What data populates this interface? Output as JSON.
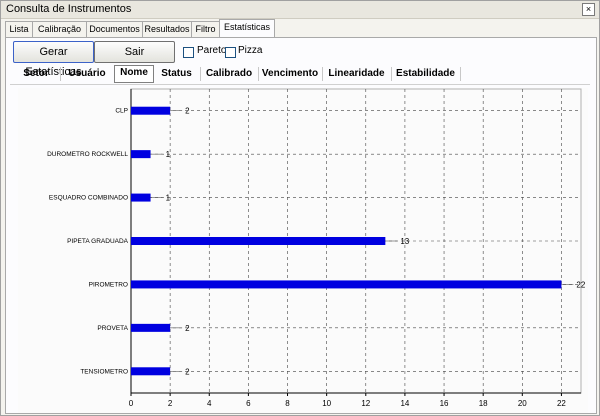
{
  "window": {
    "title": "Consulta de Instrumentos",
    "close_glyph": "×"
  },
  "tabs": [
    {
      "label": "Lista"
    },
    {
      "label": "Calibração"
    },
    {
      "label": "Documentos"
    },
    {
      "label": "Resultados"
    },
    {
      "label": "Filtro"
    },
    {
      "label": "Estatísticas"
    }
  ],
  "active_tab": "Estatísticas",
  "toolbar": {
    "generate_label": "Gerar Estatísticas",
    "exit_label": "Sair",
    "pareto_label": "Pareto",
    "pizza_label": "Pizza",
    "pareto_checked": false,
    "pizza_checked": false
  },
  "subtabs": [
    {
      "label": "Setor"
    },
    {
      "label": "Usuário"
    },
    {
      "label": "Nome"
    },
    {
      "label": "Status"
    },
    {
      "label": "Calibrado"
    },
    {
      "label": "Vencimento"
    },
    {
      "label": "Linearidade"
    },
    {
      "label": "Estabilidade"
    }
  ],
  "active_subtab": "Nome",
  "chart_data": {
    "type": "bar",
    "orientation": "horizontal",
    "categories": [
      "CLP",
      "DUROMETRO ROCKWELL",
      "ESQUADRO COMBINADO",
      "PIPETA GRADUADA",
      "PIROMETRO",
      "PROVETA",
      "TENSIOMETRO"
    ],
    "values": [
      2,
      1,
      1,
      13,
      22,
      2,
      2
    ],
    "xlim": [
      0,
      23
    ],
    "xticks": [
      0,
      2,
      4,
      6,
      8,
      10,
      12,
      14,
      16,
      18,
      20,
      22
    ],
    "grid": true,
    "bar_color": "#0000e0"
  }
}
